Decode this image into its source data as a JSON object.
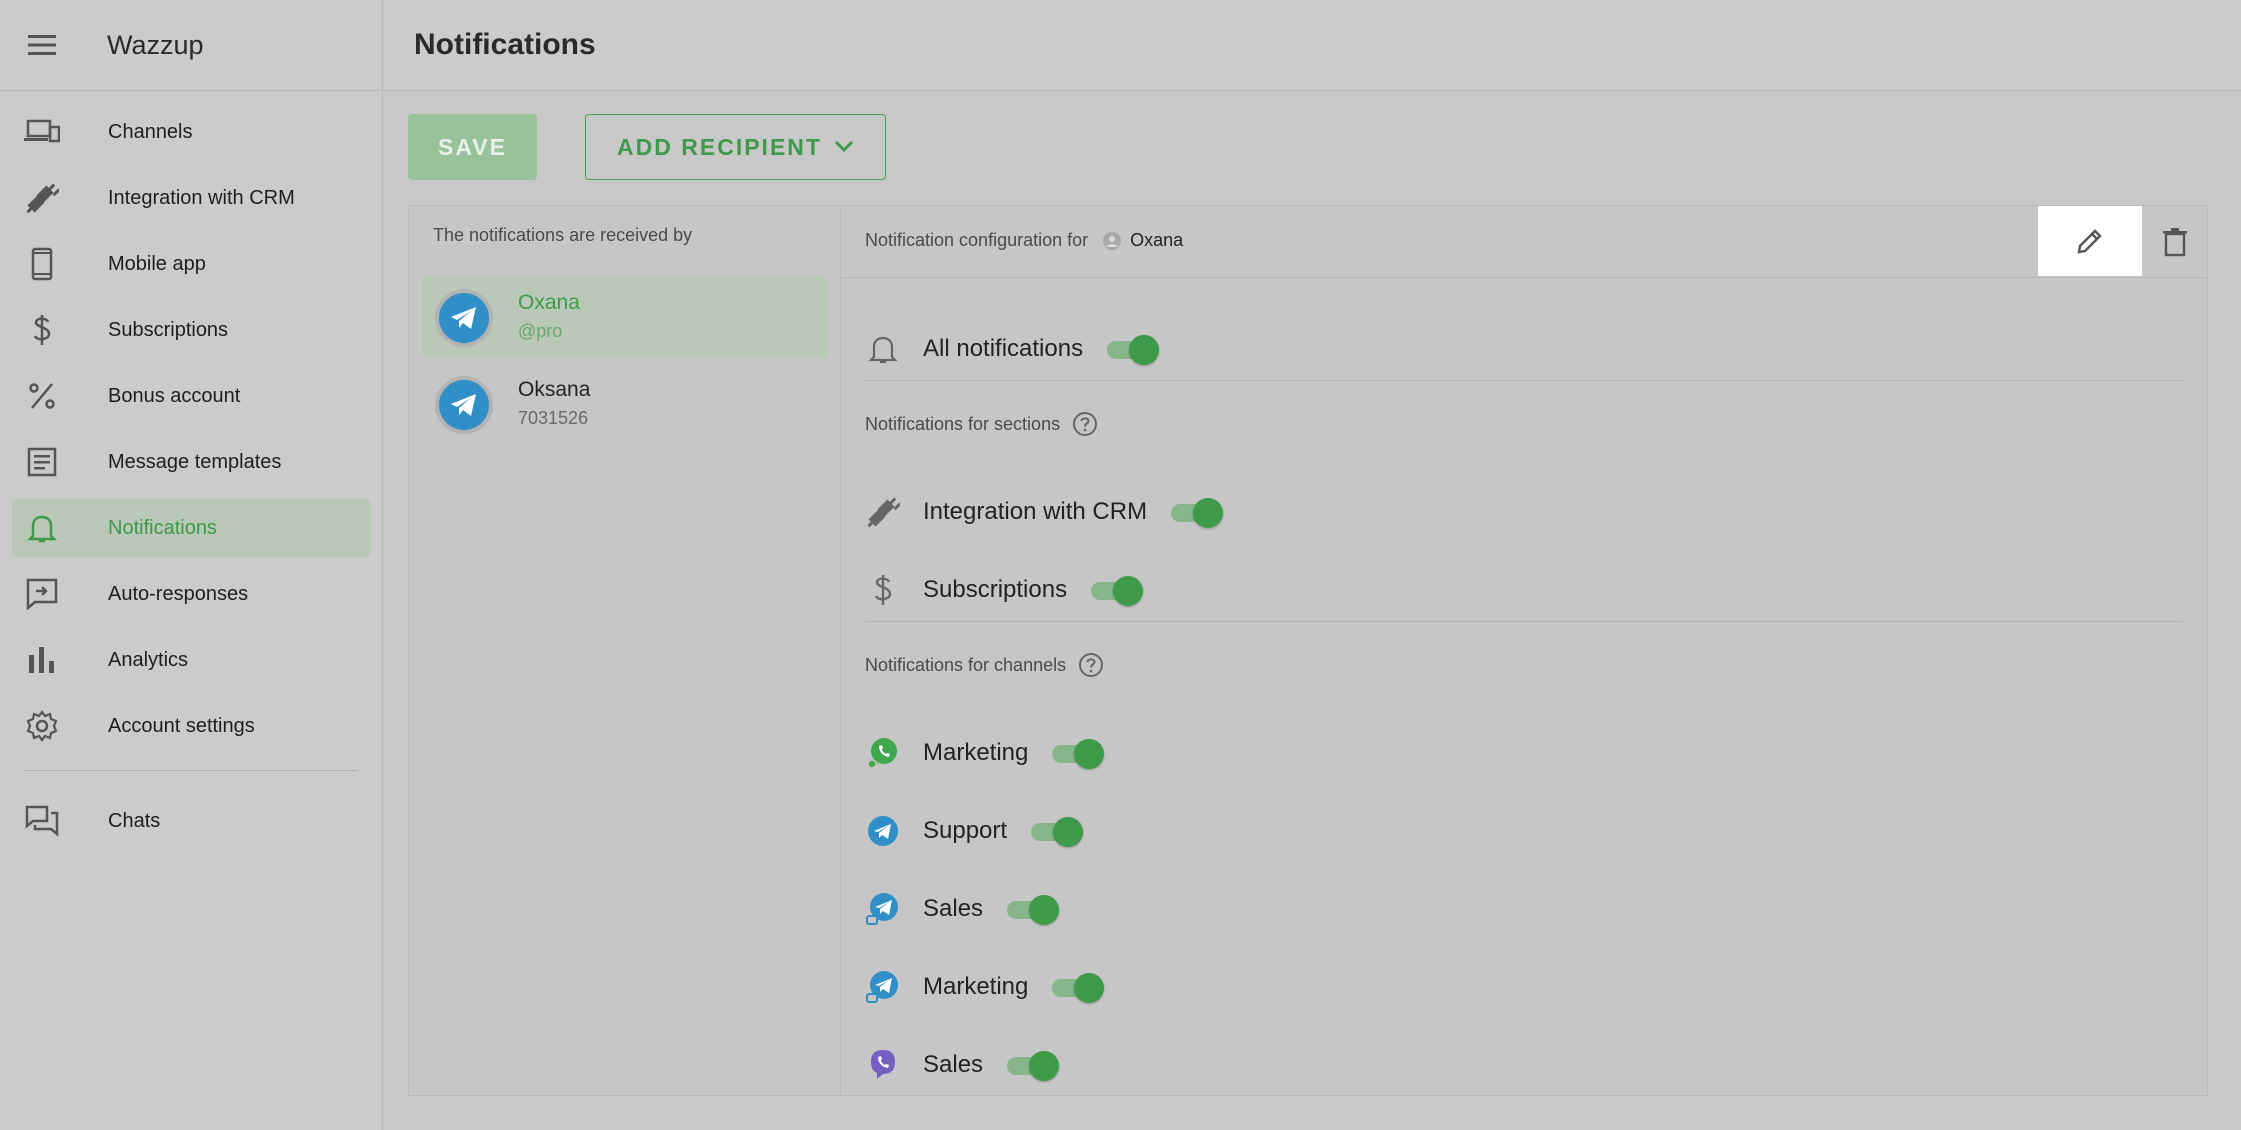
{
  "app": {
    "title": "Wazzup"
  },
  "sidebar": {
    "items": [
      {
        "label": "Channels",
        "icon": "devices-icon"
      },
      {
        "label": "Integration with CRM",
        "icon": "plug-icon"
      },
      {
        "label": "Mobile app",
        "icon": "phone-icon"
      },
      {
        "label": "Subscriptions",
        "icon": "dollar-icon"
      },
      {
        "label": "Bonus account",
        "icon": "percent-icon"
      },
      {
        "label": "Message templates",
        "icon": "template-icon"
      },
      {
        "label": "Notifications",
        "icon": "bell-icon",
        "active": true
      },
      {
        "label": "Auto-responses",
        "icon": "auto-response-icon"
      },
      {
        "label": "Analytics",
        "icon": "bar-chart-icon"
      },
      {
        "label": "Account settings",
        "icon": "gear-icon"
      }
    ],
    "chats": {
      "label": "Chats",
      "icon": "chats-icon"
    }
  },
  "header": {
    "title": "Notifications"
  },
  "toolbar": {
    "save_label": "SAVE",
    "add_label": "ADD RECIPIENT"
  },
  "recipients": {
    "title": "The notifications are received by",
    "items": [
      {
        "name": "Oxana",
        "sub": "@pro",
        "active": true
      },
      {
        "name": "Oksana",
        "sub": "7031526",
        "active": false
      }
    ]
  },
  "config": {
    "title": "Notification configuration for",
    "user": "Oxana",
    "all_label": "All notifications",
    "all_enabled": true,
    "sections_title": "Notifications for sections",
    "sections": [
      {
        "label": "Integration with CRM",
        "icon": "plug-icon",
        "enabled": true
      },
      {
        "label": "Subscriptions",
        "icon": "dollar-icon",
        "enabled": true
      }
    ],
    "channels_title": "Notifications for channels",
    "channels": [
      {
        "label": "Marketing",
        "icon": "whatsapp-icon",
        "enabled": true
      },
      {
        "label": "Support",
        "icon": "telegram-icon",
        "enabled": true
      },
      {
        "label": "Sales",
        "icon": "telegram-personal-icon",
        "enabled": true
      },
      {
        "label": "Marketing",
        "icon": "telegram-personal-icon",
        "enabled": true
      },
      {
        "label": "Sales",
        "icon": "viber-icon",
        "enabled": true
      }
    ]
  },
  "colors": {
    "accent": "#3d9a48",
    "telegram": "#2f8fc6",
    "viber": "#7360c0",
    "whatsapp": "#3fa84c"
  }
}
